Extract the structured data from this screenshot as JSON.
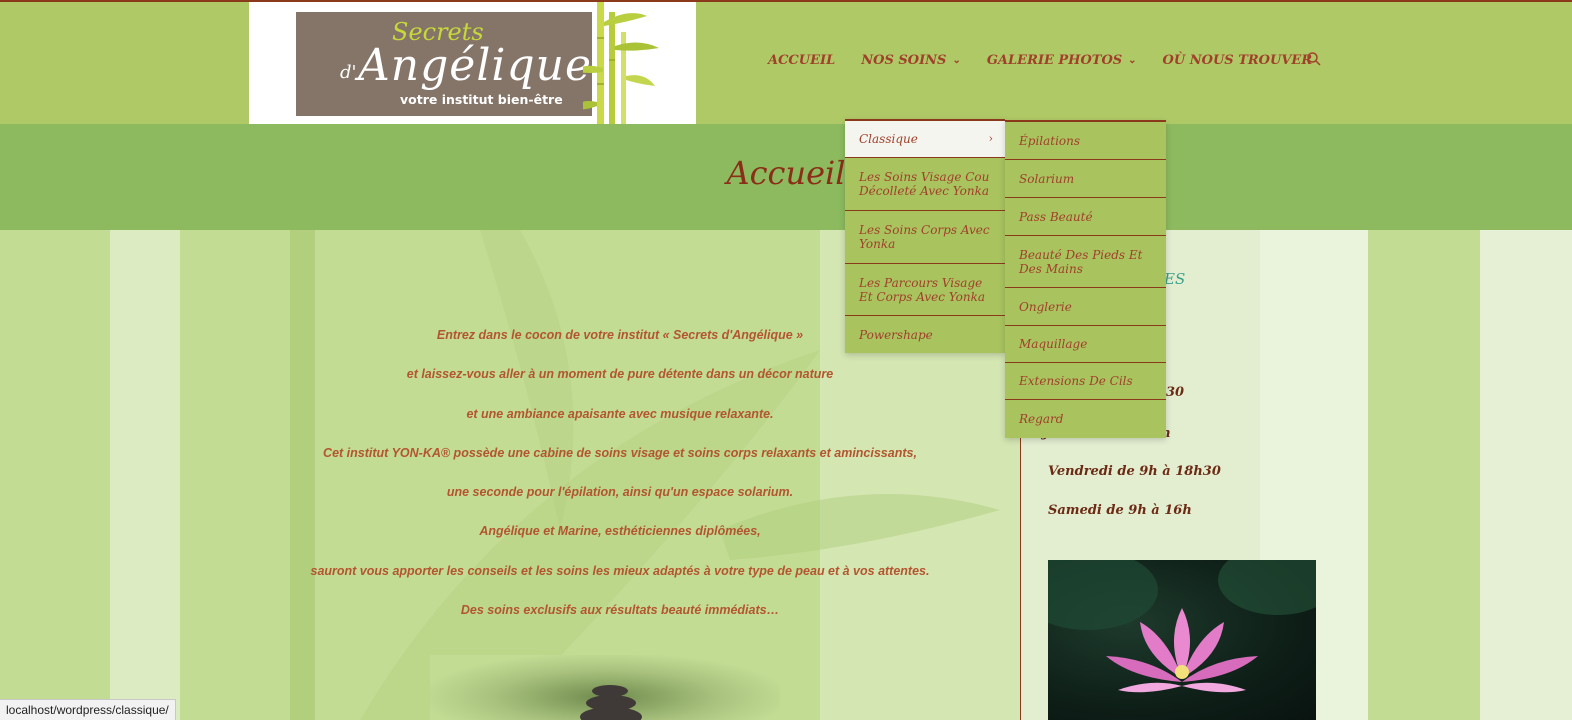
{
  "logo": {
    "secrets": "Secrets",
    "d": "d'",
    "name": "Angélique",
    "tagline": "votre institut bien-être"
  },
  "nav": {
    "items": [
      {
        "label": "ACCUEIL"
      },
      {
        "label": "NOS SOINS"
      },
      {
        "label": "GALERIE PHOTOS"
      },
      {
        "label": "OÙ NOUS TROUVER"
      }
    ],
    "search_icon": "search-icon"
  },
  "page_title": "Accueil",
  "intro": {
    "lines": [
      "Entrez dans le cocon de votre institut « Secrets d'Angélique »",
      "et laissez-vous aller à un moment de pure détente dans un décor nature",
      "et une ambiance apaisante avec musique relaxante.",
      "Cet institut YON-KA® possède une cabine de soins visage et soins corps relaxants et amincissants,",
      "une seconde pour l'épilation, ainsi qu'un espace solarium.",
      "Angélique et Marine, esthéticiennes diplômées,",
      "sauront vous apporter les conseils et les soins les mieux adaptés à votre type de peau et à vos attentes.",
      "Des soins exclusifs aux résultats beauté immédiats…"
    ]
  },
  "sidebar": {
    "heading_partial": "ES",
    "partial_time_1": "30",
    "partial_time_2": "Jeudi de 9h à 19h",
    "hours": [
      "Vendredi de 9h à 18h30",
      "Samedi de 9h à 16h"
    ]
  },
  "dropdown_main": {
    "items": [
      {
        "label": "Classique",
        "arrow": "›",
        "active": true
      },
      {
        "label": "Les Soins Visage Cou Décolleté Avec Yonka"
      },
      {
        "label": "Les Soins Corps Avec Yonka"
      },
      {
        "label": "Les Parcours Visage Et Corps Avec Yonka"
      },
      {
        "label": "Powershape"
      }
    ]
  },
  "dropdown_sub": {
    "items": [
      {
        "label": "Épilations"
      },
      {
        "label": "Solarium"
      },
      {
        "label": "Pass Beauté"
      },
      {
        "label": "Beauté Des Pieds Et Des Mains"
      },
      {
        "label": "Onglerie"
      },
      {
        "label": "Maquillage"
      },
      {
        "label": "Extensions De Cils"
      },
      {
        "label": "Regard"
      }
    ]
  },
  "statusbar": {
    "url": "localhost/wordpress/classique/"
  },
  "colors": {
    "header_bg": "#b0c967",
    "title_band": "#8dba5f",
    "accent_text": "#a0402a",
    "title_text": "#8a2e18",
    "border": "#8a3a1a"
  }
}
